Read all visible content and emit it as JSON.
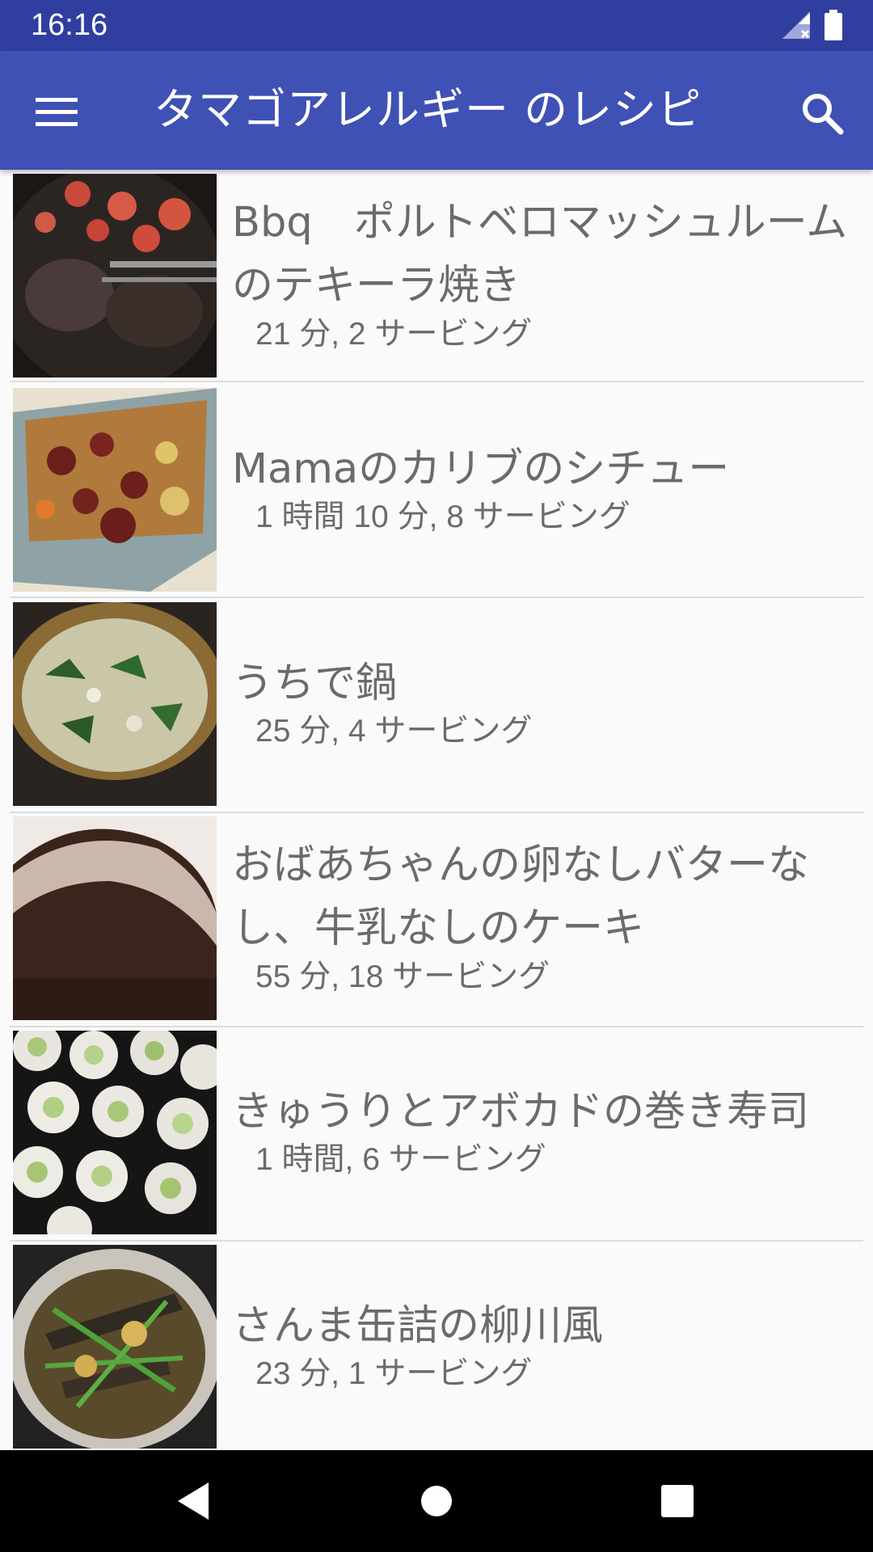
{
  "status_bar": {
    "time": "16:16"
  },
  "app_bar": {
    "title": "タマゴアレルギー のレシピ"
  },
  "recipes": [
    {
      "title": "Bbq　ポルトベロマッシュルームのテキーラ焼き",
      "meta": "21 分, 2 サービング"
    },
    {
      "title": "Mamaのカリブのシチュー",
      "meta": "1 時間 10 分, 8 サービング"
    },
    {
      "title": "うちで鍋",
      "meta": "25 分, 4 サービング"
    },
    {
      "title": "おばあちゃんの卵なしバターなし、牛乳なしのケーキ",
      "meta": "55 分, 18 サービング"
    },
    {
      "title": "きゅうりとアボカドの巻き寿司",
      "meta": "1 時間, 6 サービング"
    },
    {
      "title": "さんま缶詰の柳川風",
      "meta": "23 分, 1 サービング"
    }
  ],
  "colors": {
    "status_bar": "#303f9f",
    "app_bar": "#3f51b5",
    "text": "#6b6b6b"
  }
}
